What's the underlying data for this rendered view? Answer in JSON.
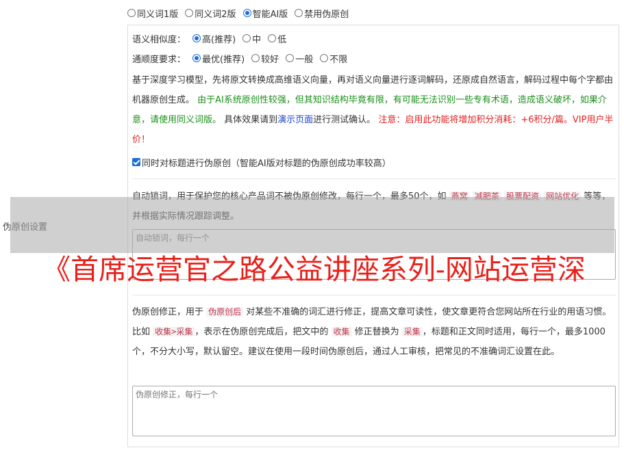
{
  "mode_options": [
    {
      "label": "同义词1版",
      "selected": false
    },
    {
      "label": "同义词2版",
      "selected": false
    },
    {
      "label": "智能AI版",
      "selected": true
    },
    {
      "label": "禁用伪原创",
      "selected": false
    }
  ],
  "left_label": "伪原创设置",
  "similarity": {
    "label": "语义相似度：",
    "options": [
      {
        "label": "高(推荐)",
        "selected": true
      },
      {
        "label": "中",
        "selected": false
      },
      {
        "label": "低",
        "selected": false
      }
    ]
  },
  "fluency": {
    "label": "通顺度要求：",
    "options": [
      {
        "label": "最优(推荐)",
        "selected": true
      },
      {
        "label": "较好",
        "selected": false
      },
      {
        "label": "一般",
        "selected": false
      },
      {
        "label": "不限",
        "selected": false
      }
    ]
  },
  "ai_desc": {
    "part1": "基于深度学习模型，先将原文转换成高维语义向量，再对语义向量进行逐词解码，还原成自然语言，解码过程中每个字都由机器原创生成。 ",
    "part2_green": "由于AI系统原创性较强，但其知识结构毕竟有限，有可能无法识别一些专有术语，造成语义破坏，如果介意，请使用同义词版。",
    "part3": " 具体效果请到",
    "link": "演示页面",
    "part4": "进行测试确认。 ",
    "part5_red": "注意：启用此功能将增加积分消耗：+6积分/篇。VIP用户半价！"
  },
  "title_checkbox": {
    "label": "同时对标题进行伪原创（智能AI版对标题的伪原创成功率较高）",
    "checked": true
  },
  "lock_words": {
    "desc_before": "自动锁词，用于保护您的核心产品词不被伪原创修改，每行一个，最多50个，如 ",
    "examples": [
      "燕窝",
      "减肥茶",
      "股票配资",
      "网站优化"
    ],
    "desc_after": " 等等，并根据实际情况跟踪调整。",
    "placeholder": "自动锁词，每行一个"
  },
  "correction": {
    "t1": "伪原创修正，用于 ",
    "c1": "伪原创后",
    "t2": " 对某些不准确的词汇进行修正，提高文章可读性，使文章更符合您网站所在行业的用语习惯。比如 ",
    "c2": "收集>采集",
    "t3": "，表示在伪原创完成后，把文中的 ",
    "c3": "收集",
    "t4": " 修正替换为 ",
    "c4": "采集",
    "t5": "，标题和正文同时适用，每行一个，最多1000个，不分大小写，默认留空。建议在使用一段时间伪原创后，通过人工审核，把常见的不准确词汇设置在此。",
    "placeholder": "伪原创修正，每行一个"
  },
  "watermark_text": "《首席运营官之路公益讲座系列-网站运营深",
  "colors": {
    "accent": "#1a6fd6",
    "green": "#1a8f1a",
    "red": "#e02020",
    "link": "#1a44c8",
    "code": "#c0334a"
  }
}
